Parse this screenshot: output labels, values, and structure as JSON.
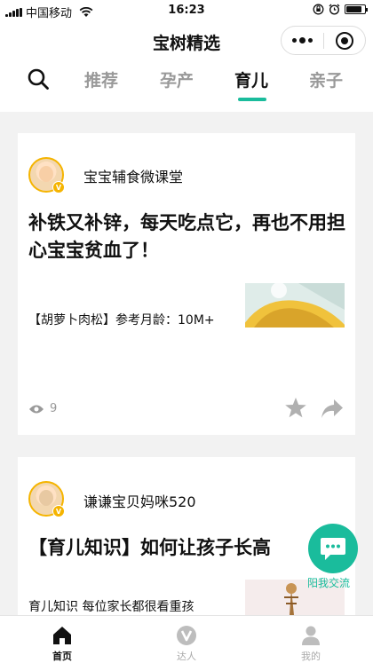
{
  "status_bar": {
    "carrier": "中国移动",
    "time": "16:23"
  },
  "nav": {
    "title": "宝树精选"
  },
  "tabs": [
    {
      "label": "推荐",
      "active": false
    },
    {
      "label": "孕产",
      "active": false
    },
    {
      "label": "育儿",
      "active": true
    },
    {
      "label": "亲子",
      "active": false
    }
  ],
  "posts": [
    {
      "author": "宝宝辅食微课堂",
      "title": "补铁又补锌，每天吃点它，再也不用担心宝宝贫血了！",
      "summary": "【胡萝卜肉松】参考月龄：10M+",
      "views": "9"
    },
    {
      "author": "谦谦宝贝妈咪520",
      "title": "【育儿知识】如何让孩子长高",
      "summary": "育儿知识 每位家长都很看重孩"
    }
  ],
  "float_button": {
    "label": "阳我交流"
  },
  "bottom_nav": [
    {
      "label": "首页",
      "icon": "home-icon",
      "active": true
    },
    {
      "label": "达人",
      "icon": "expert-v-icon",
      "active": false
    },
    {
      "label": "我的",
      "icon": "person-icon",
      "active": false
    }
  ],
  "colors": {
    "accent": "#1abc9c",
    "badge": "#f5b400"
  }
}
